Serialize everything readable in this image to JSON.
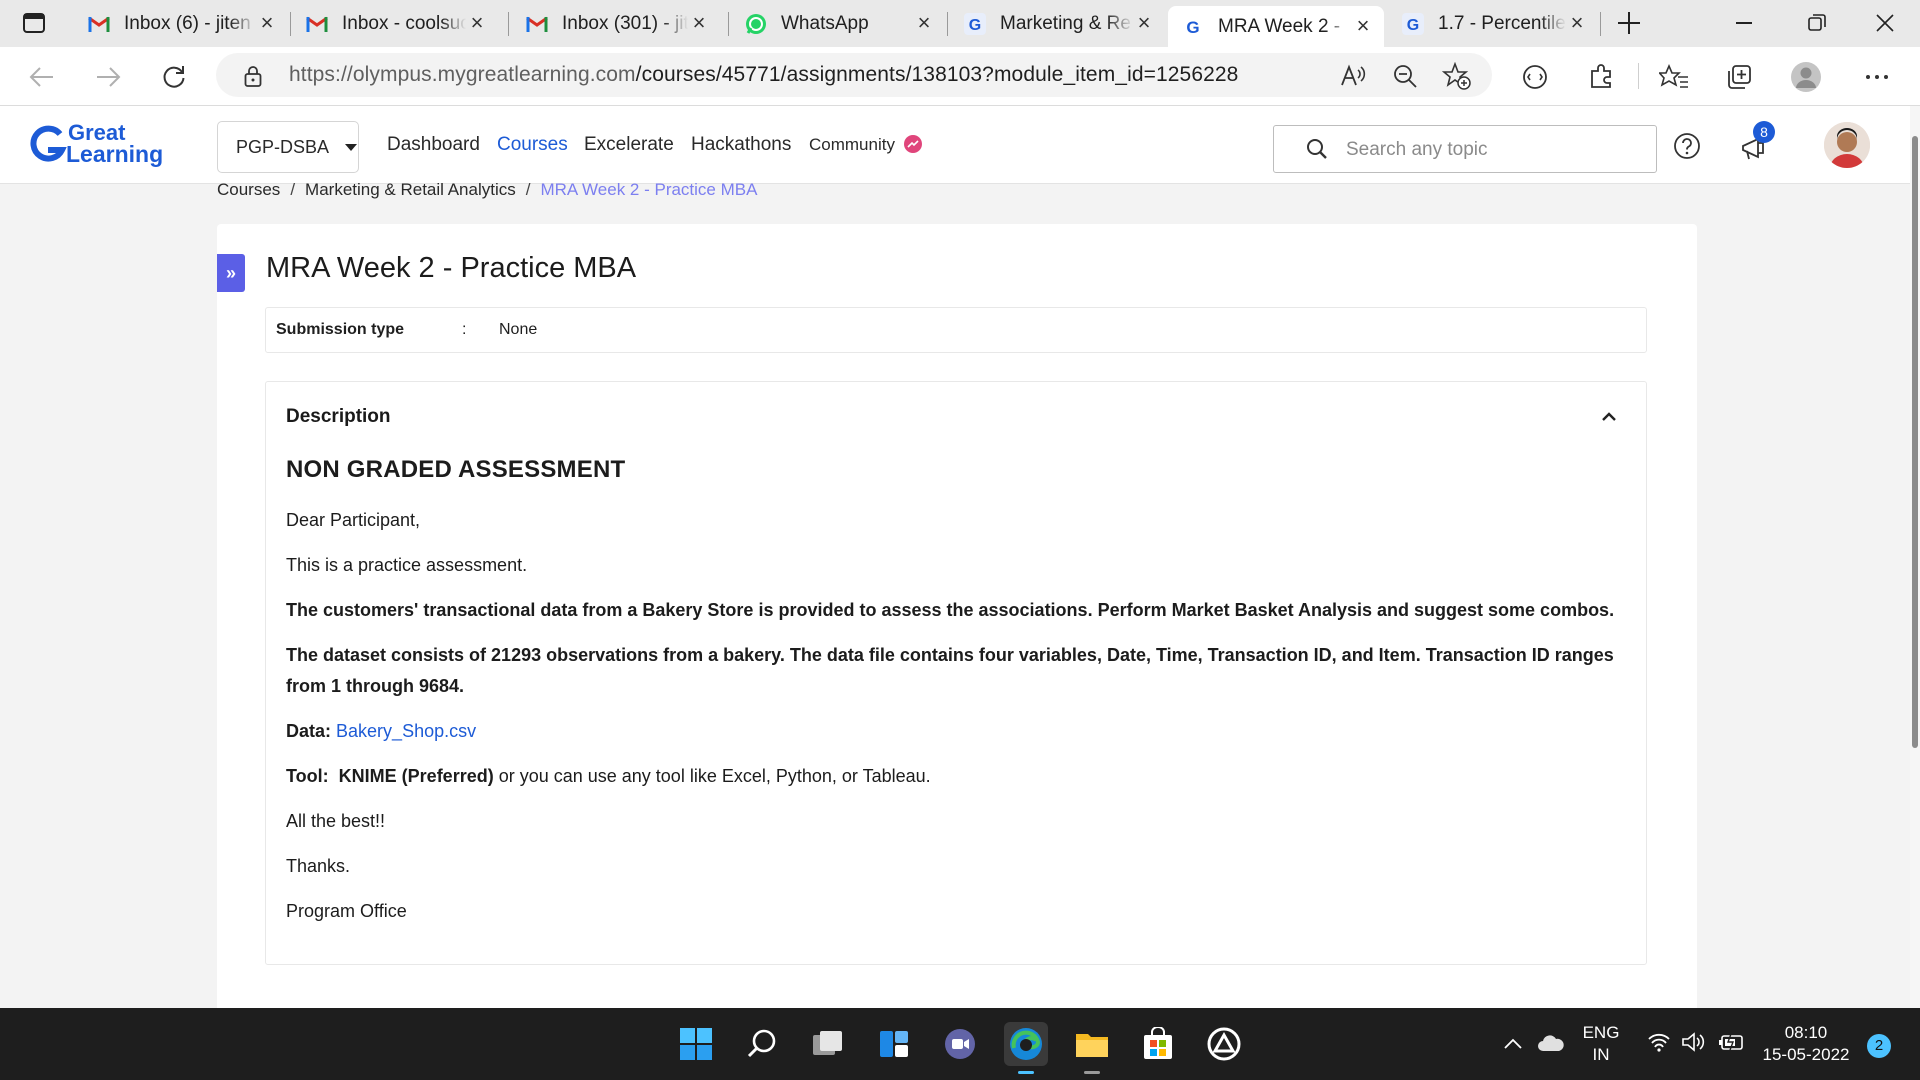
{
  "browser": {
    "tabs": [
      {
        "title": "Inbox (6) - jiten",
        "icon": "gmail-icon"
      },
      {
        "title": "Inbox - coolsuc",
        "icon": "gmail-icon"
      },
      {
        "title": "Inbox (301) - jit",
        "icon": "gmail-icon"
      },
      {
        "title": "WhatsApp",
        "icon": "whatsapp-icon"
      },
      {
        "title": "Marketing & Re",
        "icon": "greatlearning-favicon"
      },
      {
        "title": "MRA Week 2 -",
        "icon": "greatlearning-favicon",
        "active": true
      },
      {
        "title": "1.7 - Percentile",
        "icon": "greatlearning-favicon"
      }
    ],
    "url_host": "https://olympus.mygreatlearning.com",
    "url_path": "/courses/45771/assignments/138103?module_item_id=1256228"
  },
  "header": {
    "logo_line1": "Great",
    "logo_line2": "Learning",
    "program": "PGP-DSBA",
    "nav": [
      "Dashboard",
      "Courses",
      "Excelerate",
      "Hackathons",
      "Community"
    ],
    "active_nav": "Courses",
    "search_placeholder": "Search any topic",
    "notification_count": "8"
  },
  "breadcrumb": {
    "items": [
      "Courses",
      "Marketing & Retail Analytics"
    ],
    "current": "MRA Week 2 - Practice MBA",
    "separator": "/"
  },
  "assignment": {
    "title": "MRA Week 2 - Practice MBA",
    "submission_label": "Submission type",
    "submission_colon": ":",
    "submission_value": "None",
    "description_heading": "Description",
    "body": {
      "heading": "NON GRADED ASSESSMENT",
      "greeting": "Dear Participant,",
      "intro": "This is a practice assessment.",
      "para1": "The customers' transactional data from a Bakery Store is provided to assess the associations. Perform Market Basket Analysis and suggest some combos.",
      "para2": "The dataset consists of 21293 observations from a bakery. The data file contains four variables, Date, Time, Transaction ID, and Item. Transaction ID ranges from 1 through 9684.",
      "data_label": "Data:",
      "data_link": "Bakery_Shop.csv",
      "tool_label": "Tool:",
      "tool_preferred": "KNIME (Preferred)",
      "tool_rest": " or you can use any tool like Excel, Python, or Tableau.",
      "closing1": "All the best!!",
      "closing2": "Thanks.",
      "signature": "Program Office"
    }
  },
  "taskbar": {
    "lang_line1": "ENG",
    "lang_line2": "IN",
    "time": "08:10",
    "date": "15-05-2022",
    "notif_badge": "2"
  },
  "colors": {
    "accent": "#1d5bd6",
    "breadcrumb_current": "#7c7ff0",
    "sidebar_toggle": "#5b5fe6",
    "community_badge": "#e0457b",
    "taskbar": "#1e1e1e"
  }
}
